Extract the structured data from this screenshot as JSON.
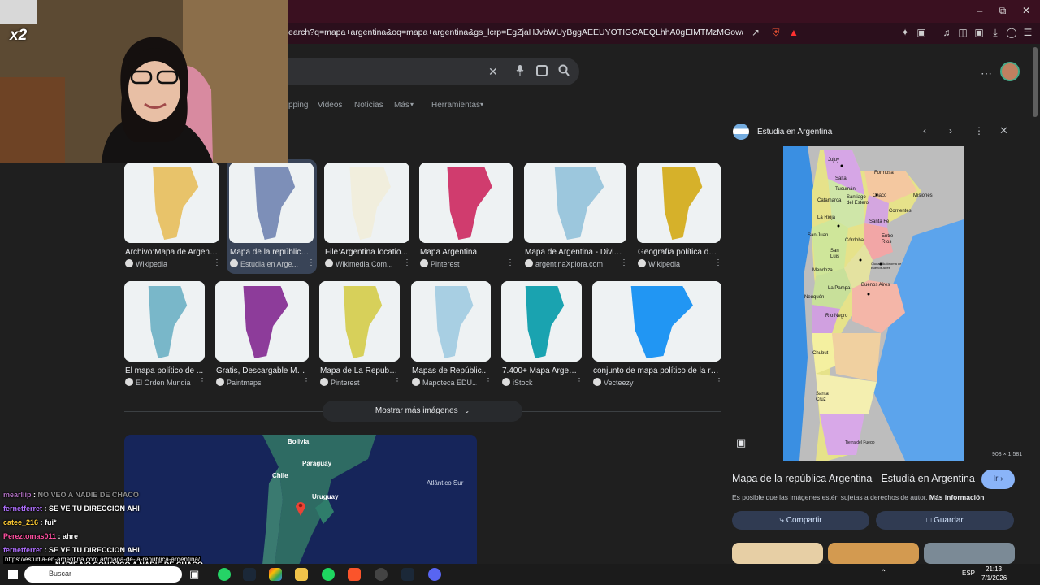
{
  "browser": {
    "url": "earch?q=mapa+argentina&oq=mapa+argentina&gs_lcrp=EgZjaHJvbWUyBggAEEUYOTIGCAEQLhhA0gEIMTMzMGowajGoAgCwAgA&s..."
  },
  "search": {
    "tabs": [
      "pping",
      "Videos",
      "Noticias",
      "Más",
      "Herramientas"
    ],
    "more_images_label": "Mostrar más imágenes"
  },
  "results_row1": [
    {
      "title": "Archivo:Mapa de Argentin...",
      "source": "Wikipedia",
      "color": "#e8c36a"
    },
    {
      "title": "Mapa de la república ...",
      "source": "Estudia en Arge...",
      "color": "#7d8fb8"
    },
    {
      "title": "File:Argentina locatio...",
      "source": "Wikimedia Com...",
      "color": "#f1eedd"
    },
    {
      "title": "Mapa Argentina",
      "source": "Pinterest",
      "color": "#d03c6e"
    },
    {
      "title": "Mapa de Argentina - Divisi...",
      "source": "argentinaXplora.com",
      "color": "#9cc7dd"
    },
    {
      "title": "Geografía política de ...",
      "source": "Wikipedia",
      "color": "#d6b12a"
    }
  ],
  "results_row2": [
    {
      "title": "El mapa político de ...",
      "source": "El Orden Mundial",
      "color": "#79b7c9"
    },
    {
      "title": "Gratis, Descargable Ma...",
      "source": "Paintmaps",
      "color": "#8d3c9a"
    },
    {
      "title": "Mapa de La Republi...",
      "source": "Pinterest",
      "color": "#d7d05a"
    },
    {
      "title": "Mapas de Repúblic...",
      "source": "Mapoteca EDU...",
      "color": "#a8cfe3"
    },
    {
      "title": "7.400+ Mapa Argenti...",
      "source": "iStock",
      "color": "#1aa3b0"
    },
    {
      "title": "conjunto de mapa político de la rep...",
      "source": "Vecteezy",
      "color": "#2196f3"
    }
  ],
  "map": {
    "labels": [
      "Bolivia",
      "Paraguay",
      "Chile",
      "Uruguay",
      "Atlántico Sur"
    ]
  },
  "panel": {
    "site": "Estudia en Argentina",
    "title": "Mapa de la república Argentina - Estudiá en Argentina",
    "go": "Ir",
    "rights": "Es posible que las imágenes estén sujetas a derechos de autor.",
    "more_info": "Más información",
    "share": "Compartir",
    "save": "Guardar",
    "dimensions": "908 × 1.581",
    "provinces": [
      "Jujuy",
      "Salta",
      "Formosa",
      "Chaco",
      "Catamarca",
      "Santiago del Estero",
      "Tucumán",
      "La Rioja",
      "Corrientes",
      "Misiones",
      "Santa Fe",
      "Entre Ríos",
      "San Juan",
      "Córdoba",
      "San Luis",
      "Mendoza",
      "Ciudad Autónoma de Buenos Aires",
      "La Pampa",
      "Buenos Aires",
      "Neuquén",
      "Río Negro",
      "Chubut",
      "Santa Cruz",
      "Tierra del Fuego"
    ]
  },
  "overlay": {
    "badge": "x2",
    "chat": [
      {
        "user": "mearliip",
        "msg": "NO VEO A NADIE DE CHACO",
        "color": "#b06fc1"
      },
      {
        "user": "fernetferret",
        "msg": "SE VE TU DIRECCION AHI",
        "color": "#b06fff"
      },
      {
        "user": "catee_216",
        "msg": "fui*",
        "color": "#ffcc33"
      },
      {
        "user": "Pereztomas011",
        "msg": "ahre",
        "color": "#ff4fa0"
      },
      {
        "user": "fernetferret",
        "msg": "SE VE TU DIRECCION AHI",
        "color": "#b06fff"
      }
    ],
    "link": "https://estudia-en-argentina.com.ar/mapa-de-la-republica-argentina/",
    "partial_line": "NADIE NO CONOZCO A NADIE DE CHACO"
  },
  "taskbar": {
    "search": "Buscar",
    "lang": "ESP",
    "time": "21:13",
    "date": "7/1/2026"
  }
}
